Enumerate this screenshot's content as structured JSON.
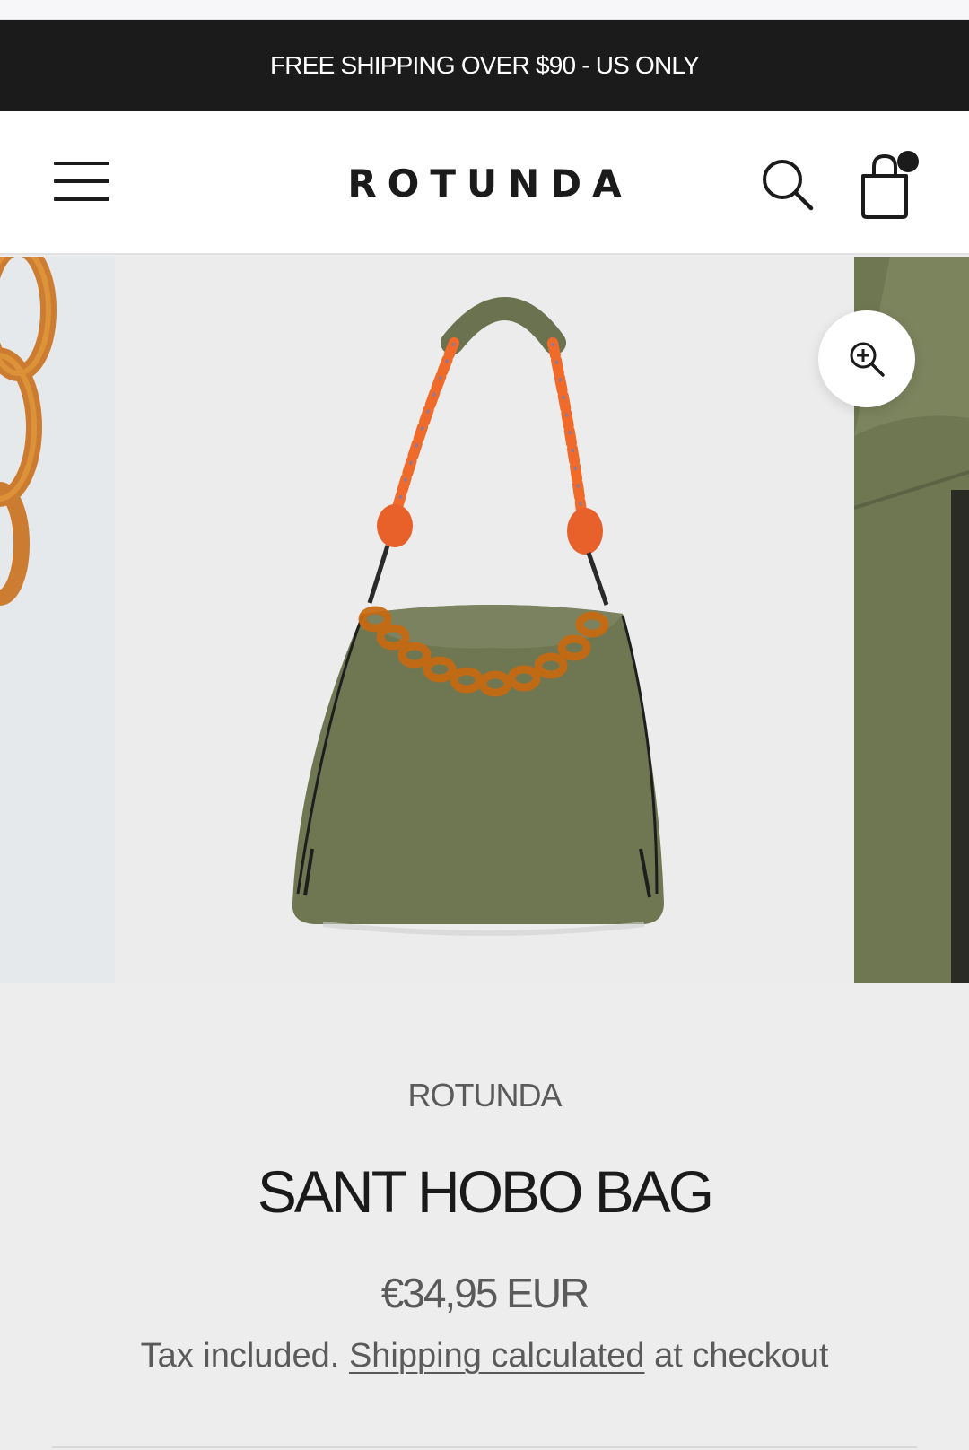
{
  "announcement": {
    "text": "FREE SHIPPING OVER $90 - US ONLY"
  },
  "header": {
    "logo": "ROTUNDA",
    "menu_icon": "hamburger-menu-icon",
    "search_icon": "search-icon",
    "cart_icon": "shopping-bag-icon",
    "cart_has_items": true
  },
  "gallery": {
    "zoom_icon": "zoom-in-icon",
    "images": [
      {
        "alt": "amber chain detail"
      },
      {
        "alt": "khaki hobo bag with orange rope handle and amber chain"
      },
      {
        "alt": "khaki bag fabric close-up"
      }
    ]
  },
  "product": {
    "vendor": "ROTUNDA",
    "title": "SANT HOBO BAG",
    "price": "€34,95 EUR",
    "tax_prefix": "Tax included.",
    "shipping_link": "Shipping calculated",
    "tax_suffix": "at checkout"
  },
  "colors": {
    "announcement_bg": "#1c1b1b",
    "page_bg": "#ededed",
    "bag_green": "#6e7652",
    "rope_orange": "#f06a2a",
    "chain_amber": "#c86a10"
  }
}
